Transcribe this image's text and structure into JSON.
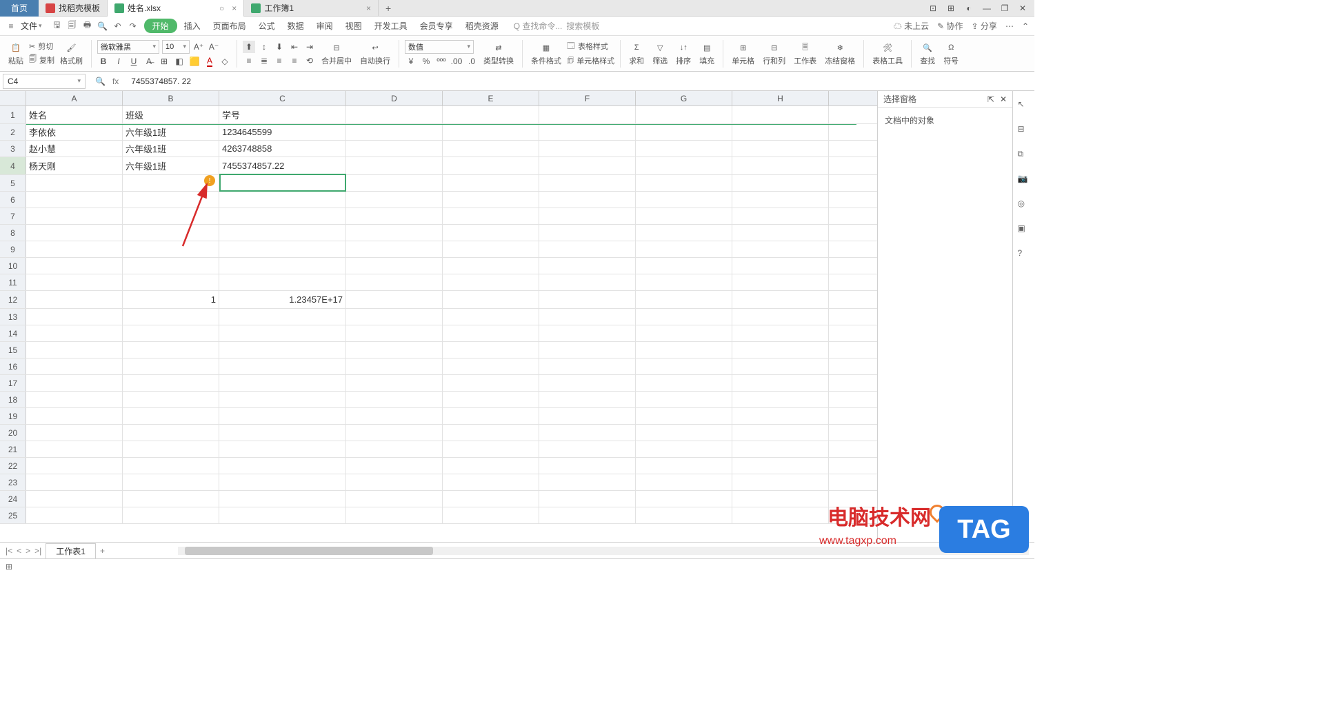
{
  "titlebar": {
    "home": "首页",
    "tab1": "找稻壳模板",
    "tab2": "姓名.xlsx",
    "tab3": "工作簿1",
    "add": "+"
  },
  "menu": {
    "file": "文件",
    "items": [
      "开始",
      "插入",
      "页面布局",
      "公式",
      "数据",
      "审阅",
      "视图",
      "开发工具",
      "会员专享",
      "稻壳资源"
    ],
    "search1": "查找命令...",
    "search2": "搜索模板",
    "cloud": "未上云",
    "coop": "协作",
    "share": "分享"
  },
  "ribbon": {
    "paste": "粘贴",
    "cut": "剪切",
    "copy": "复制",
    "format_painter": "格式刷",
    "font_name": "微软雅黑",
    "font_size": "10",
    "merge": "合并居中",
    "wrap": "自动换行",
    "num_format": "数值",
    "type_conv": "类型转换",
    "cond_format": "条件格式",
    "table_fmt": "表格样式",
    "cell_fmt": "单元格样式",
    "sum": "求和",
    "filter": "筛选",
    "sort": "排序",
    "fill": "填充",
    "cell": "单元格",
    "rowcol": "行和列",
    "sheet": "工作表",
    "freeze": "冻结窗格",
    "table_tools": "表格工具",
    "find": "查找",
    "symbol": "符号"
  },
  "formula": {
    "cell_ref": "C4",
    "fx": "fx",
    "value": "7455374857. 22"
  },
  "columns": [
    "A",
    "B",
    "C",
    "D",
    "E",
    "F",
    "G",
    "H"
  ],
  "grid": {
    "headers": {
      "A": "姓名",
      "B": "班级",
      "C": "学号"
    },
    "rows": [
      {
        "A": "李依依",
        "B": "六年级1班",
        "C": "1234645599"
      },
      {
        "A": "赵小慧",
        "B": "六年级1班",
        "C": "4263748858"
      },
      {
        "A": "杨天刚",
        "B": "六年级1班",
        "C": "7455374857.22"
      }
    ],
    "r12": {
      "B": "1",
      "C": "1.23457E+17"
    }
  },
  "side": {
    "title": "选择窗格",
    "body": "文档中的对象"
  },
  "sheets": {
    "tab1": "工作表1",
    "add": "+"
  },
  "watermark": {
    "text": "电脑技术网",
    "url": "www.tagxp.com",
    "tag": "TAG"
  }
}
